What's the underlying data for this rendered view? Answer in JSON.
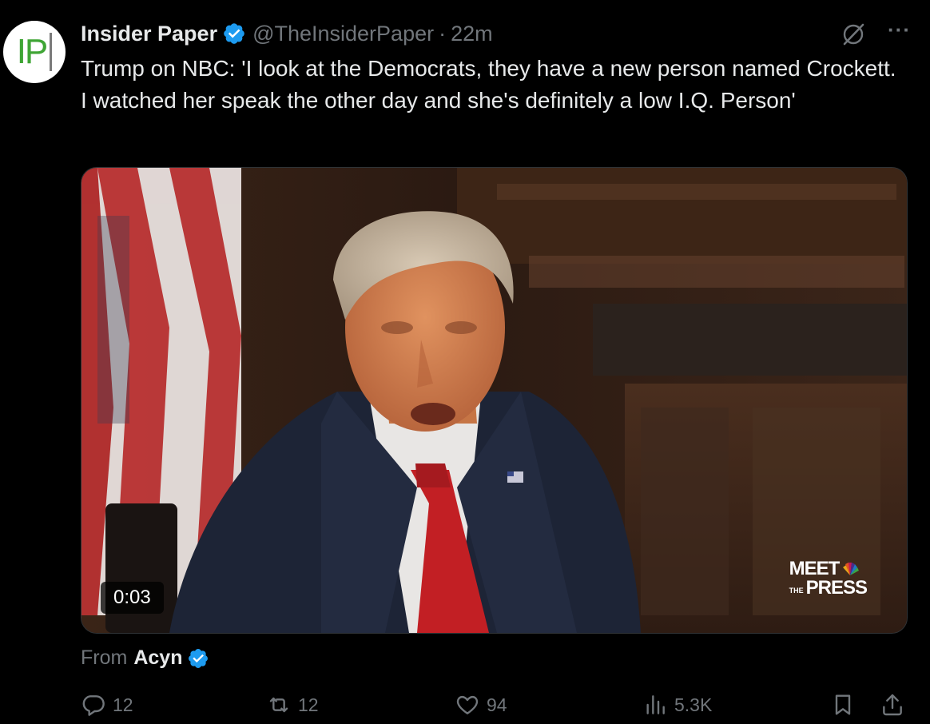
{
  "tweet": {
    "avatar_text": "IP",
    "author_name": "Insider Paper",
    "handle": "@TheInsiderPaper",
    "dot": "·",
    "time": "22m",
    "text": "Trump on NBC: 'I look at the Democrats, they have a new person named Crockett. I watched her speak the other day and she's definitely a low I.Q. Person'",
    "more_label": "···"
  },
  "media": {
    "duration": "0:03",
    "logo_line1": "MEET",
    "logo_the": "THE",
    "logo_line2": "PRESS"
  },
  "source": {
    "from_label": "From",
    "from_name": "Acyn"
  },
  "actions": {
    "replies": "12",
    "reposts": "12",
    "likes": "94",
    "views": "5.3K"
  },
  "colors": {
    "background": "#000000",
    "text": "#e7e9ea",
    "muted": "#71767b",
    "verified": "#1d9bf0",
    "avatar_green": "#3fa535"
  },
  "icons": {
    "verified": "verified-badge-icon",
    "grok": "grok-icon",
    "more": "more-icon",
    "reply": "reply-icon",
    "repost": "repost-icon",
    "like": "heart-icon",
    "views": "views-icon",
    "bookmark": "bookmark-icon",
    "share": "share-icon"
  }
}
